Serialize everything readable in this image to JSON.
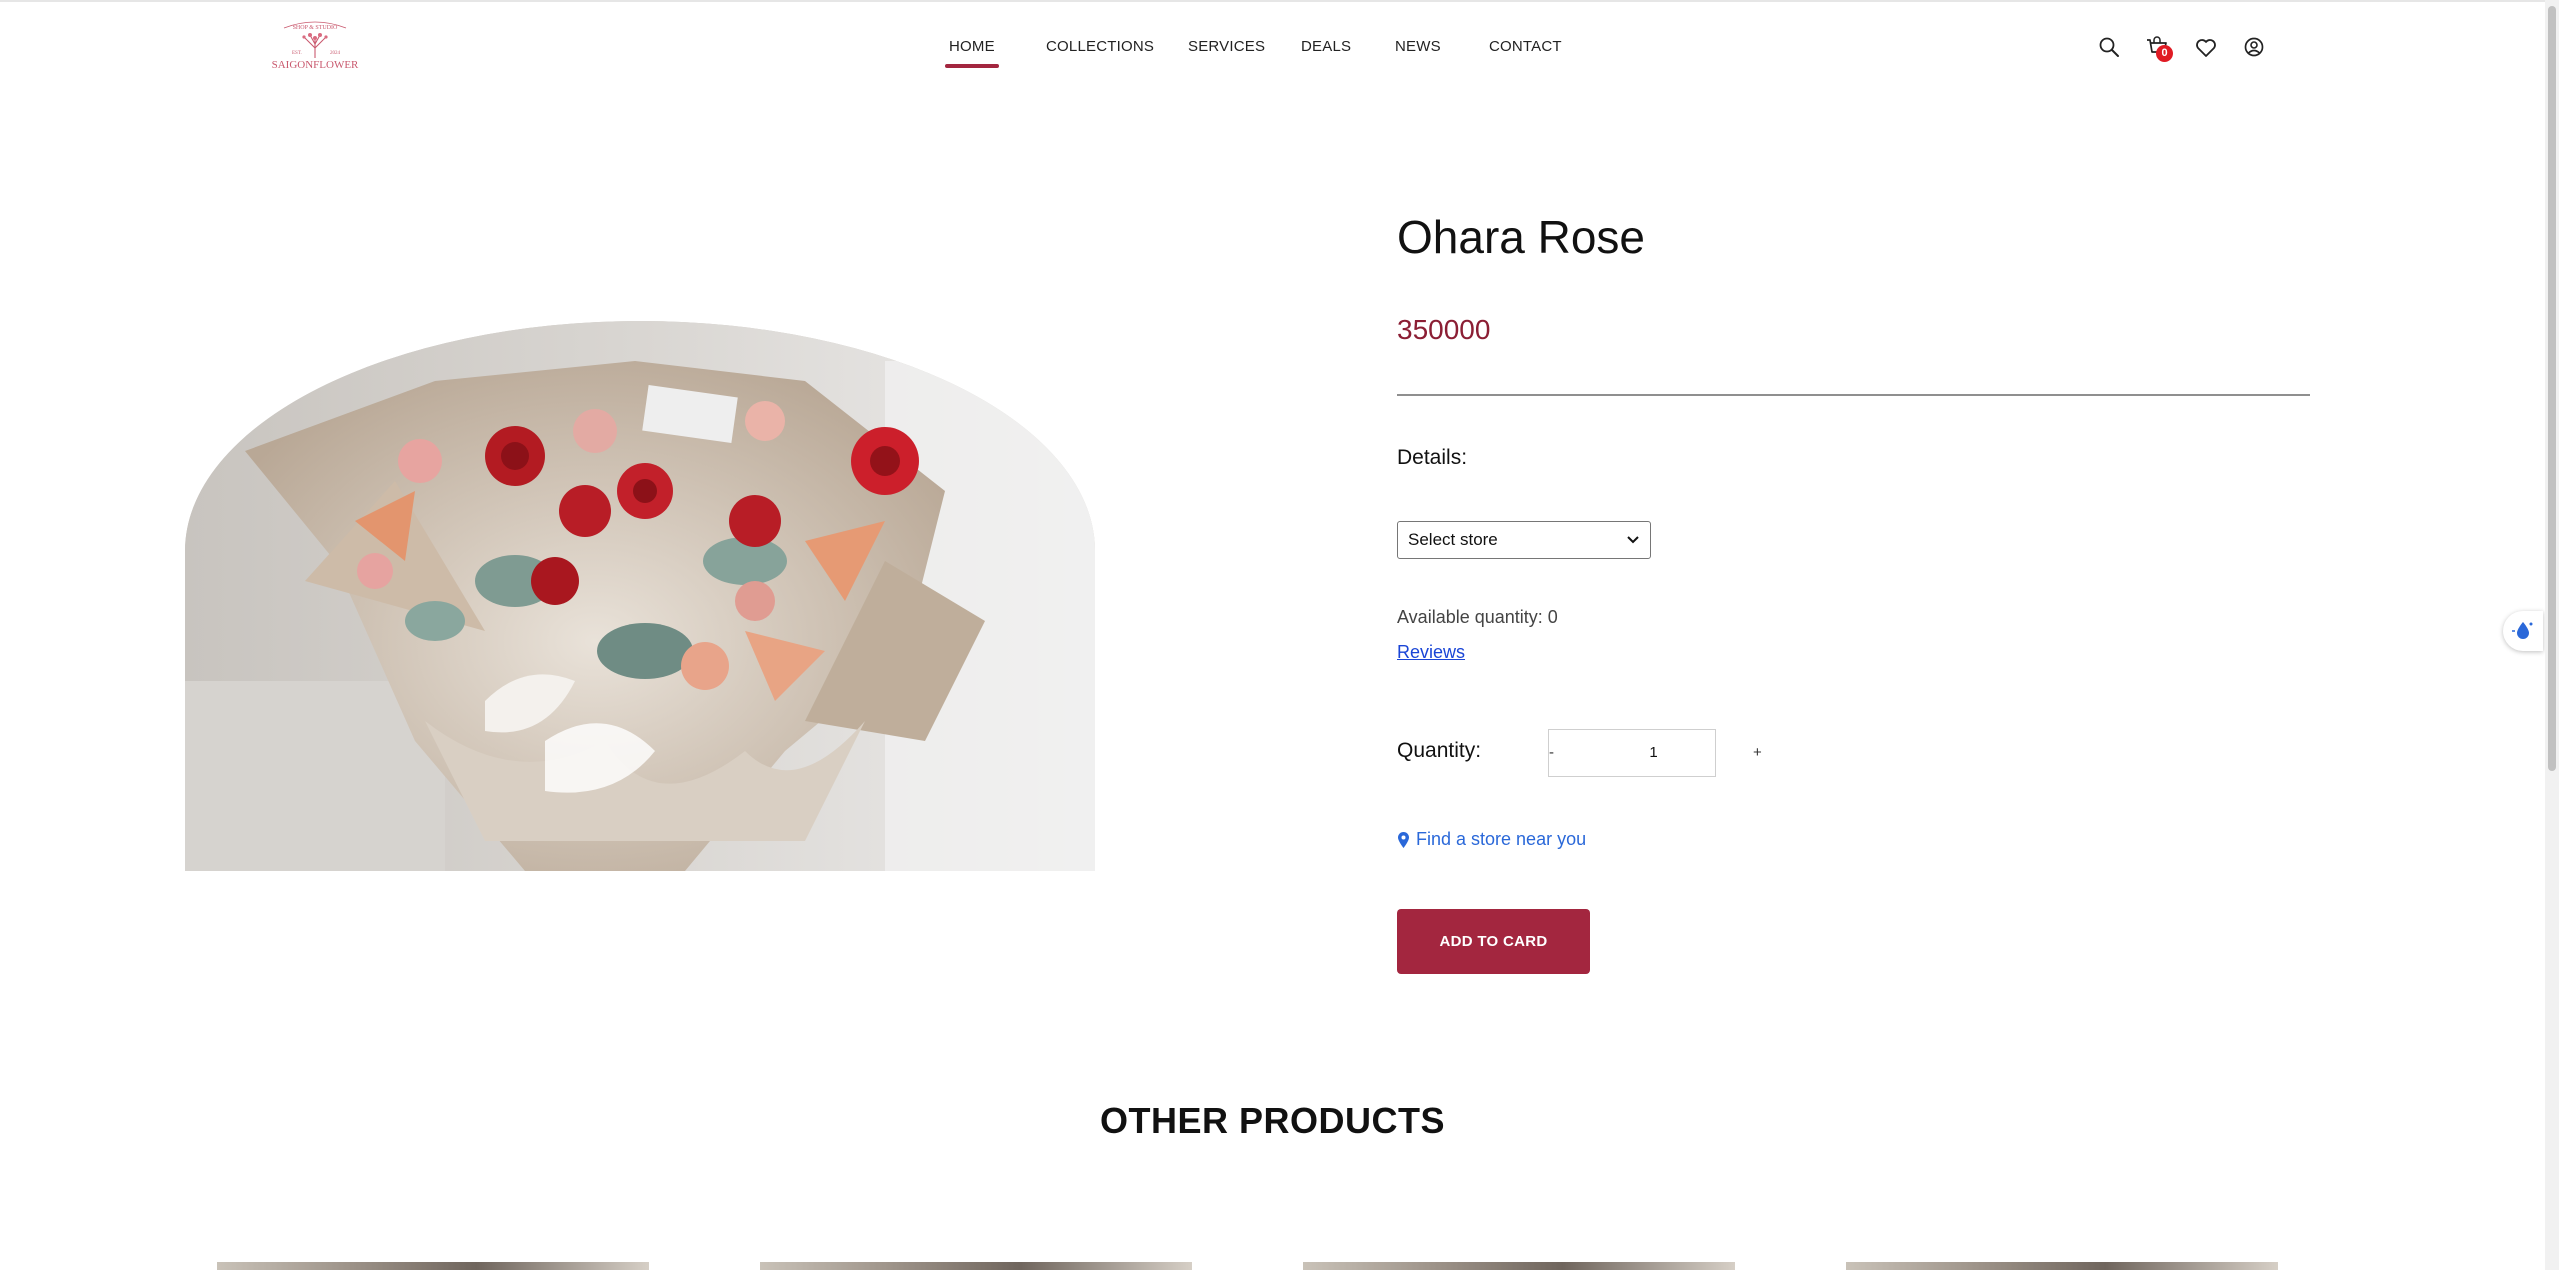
{
  "brand": {
    "logo_top_text": "SHOP & STUDIO",
    "logo_name": "SAIGONFLOWER",
    "logo_since_left": "EST.",
    "logo_since_right": "2024",
    "accent_color": "#a3263f",
    "price_color": "#8b1e34"
  },
  "nav": {
    "items": [
      {
        "label": "HOME",
        "active": true
      },
      {
        "label": "COLLECTIONS",
        "active": false
      },
      {
        "label": "SERVICES",
        "active": false
      },
      {
        "label": "DEALS",
        "active": false
      },
      {
        "label": "NEWS",
        "active": false
      },
      {
        "label": "CONTACT",
        "active": false
      }
    ]
  },
  "header_icons": {
    "search": "search-icon",
    "cart": "cart-icon",
    "cart_count": "0",
    "wishlist": "heart-icon",
    "account": "user-icon"
  },
  "product": {
    "name": "Ohara Rose",
    "price": "350000",
    "details_label": "Details:",
    "store_select": {
      "selected": "Select store"
    },
    "available_quantity": "Available quantity: 0",
    "reviews_link": "Reviews",
    "quantity_label": "Quantity:",
    "quantity_minus": "-",
    "quantity_value": "1",
    "quantity_plus": "+",
    "find_store": "Find a store near you",
    "add_button": "ADD TO CARD"
  },
  "other_products": {
    "title": "OTHER PRODUCTS"
  }
}
